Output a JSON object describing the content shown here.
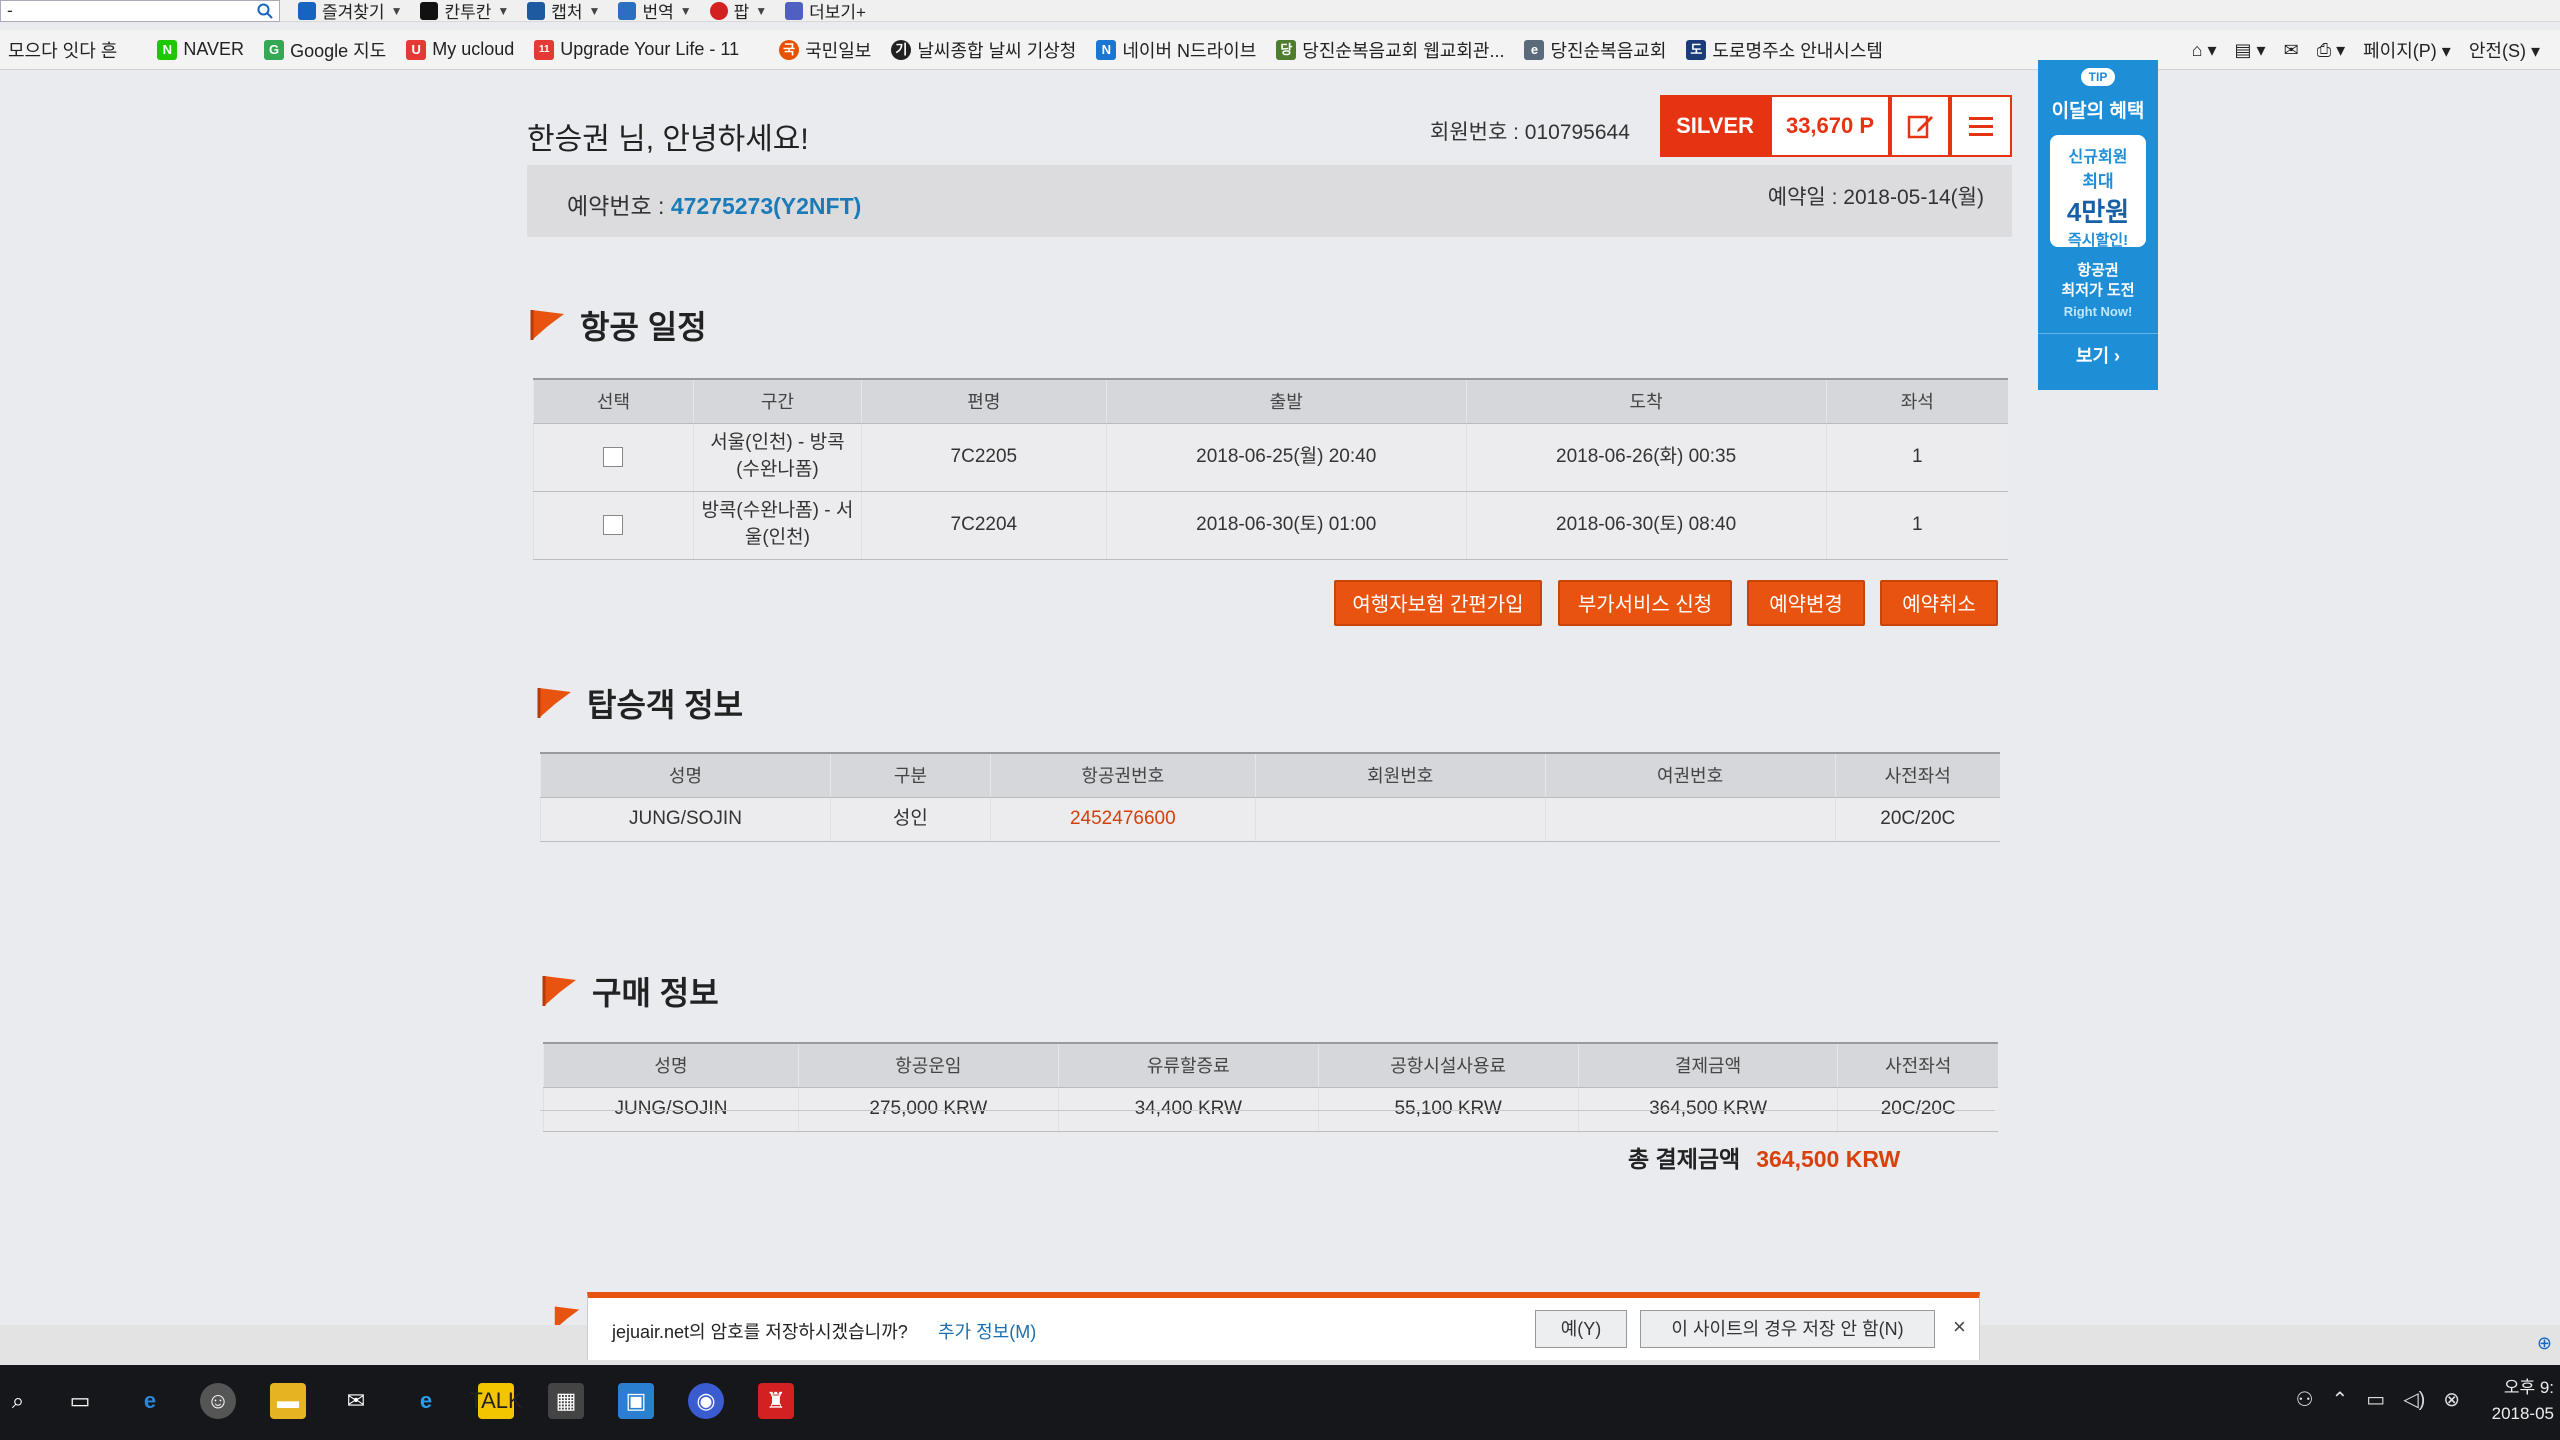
{
  "browser": {
    "address_text": "-",
    "toolbar": [
      {
        "label": "즐겨찾기",
        "color": "#1565c0"
      },
      {
        "label": "칸투칸",
        "color": "#111111"
      },
      {
        "label": "캡처",
        "color": "#1e5aa0"
      },
      {
        "label": "번역",
        "color": "#2a6fc0"
      },
      {
        "label": "팝",
        "color": "#d32020"
      },
      {
        "label": "더보기+",
        "color": "#5060c0"
      }
    ],
    "favorites_label": "모으다 잇다 흔",
    "favorites": [
      {
        "label": "NAVER",
        "color": "#1ec800",
        "letter": "N"
      },
      {
        "label": "Google 지도",
        "color": "#34a853",
        "letter": "G"
      },
      {
        "label": "My ucloud",
        "color": "#e53935",
        "letter": "U"
      },
      {
        "label": "Upgrade Your Life - 11",
        "color": "#e53935",
        "letter": "11"
      },
      {
        "label": "국민일보",
        "color": "#e65100",
        "letter": "국"
      },
      {
        "label": "날씨종합 날씨 기상청",
        "color": "#222222",
        "letter": "기"
      },
      {
        "label": "네이버 N드라이브",
        "color": "#1976d2",
        "letter": "N"
      },
      {
        "label": "당진순복음교회 웹교회관...",
        "color": "#4e7d2e",
        "letter": "당"
      },
      {
        "label": "당진순복음교회",
        "color": "#5a6a7a",
        "letter": "e"
      },
      {
        "label": "도로명주소 안내시스템",
        "color": "#1a3c78",
        "letter": "도"
      }
    ],
    "right_tools": [
      "페이지(P) ▾",
      "안전(S) ▾"
    ]
  },
  "header": {
    "welcome": "한승권 님, 안녕하세요!",
    "member_no": "회원번호 : 010795644",
    "grade": "SILVER",
    "points": "33,670 P"
  },
  "reservation": {
    "label": "예약번호 : ",
    "number": "47275273(Y2NFT)",
    "date": "예약일 : 2018-05-14(월)"
  },
  "flight_section": {
    "title": "항공 일정",
    "headers": [
      "선택",
      "구간",
      "편명",
      "출발",
      "도착",
      "좌석"
    ],
    "rows": [
      {
        "route": "서울(인천) - 방콕(수완나폼)",
        "flight": "7C2205",
        "depart": "2018-06-25(월) 20:40",
        "arrive": "2018-06-26(화) 00:35",
        "seats": "1"
      },
      {
        "route": "방콕(수완나폼) - 서울(인천)",
        "flight": "7C2204",
        "depart": "2018-06-30(토) 01:00",
        "arrive": "2018-06-30(토) 08:40",
        "seats": "1"
      }
    ],
    "buttons": [
      "여행자보험 간편가입",
      "부가서비스 신청",
      "예약변경",
      "예약취소"
    ]
  },
  "passenger_section": {
    "title": "탑승객 정보",
    "headers": [
      "성명",
      "구분",
      "항공권번호",
      "회원번호",
      "여권번호",
      "사전좌석"
    ],
    "rows": [
      {
        "name": "JUNG/SOJIN",
        "type": "성인",
        "ticket": "2452476600",
        "member": "",
        "passport": "",
        "seat": "20C/20C"
      }
    ]
  },
  "purchase_section": {
    "title": "구매 정보",
    "headers": [
      "성명",
      "항공운임",
      "유류할증료",
      "공항시설사용료",
      "결제금액",
      "사전좌석"
    ],
    "rows": [
      {
        "name": "JUNG/SOJIN",
        "fare": "275,000 KRW",
        "fuel": "34,400 KRW",
        "airport": "55,100 KRW",
        "payment": "364,500 KRW",
        "seat": "20C/20C"
      }
    ],
    "total_label": "총 결제금액",
    "total_amount": "364,500 KRW"
  },
  "tip_banner": {
    "badge": "TIP",
    "title": "이달의 혜택",
    "card": [
      "신규회원",
      "최대",
      "4만원",
      "즉시할인!"
    ],
    "sub": [
      "항공권",
      "최저가 도전"
    ],
    "sub2": "Right Now!",
    "view": "보기 ›"
  },
  "notification": {
    "message": "jejuair.net의 암호를 저장하시겠습니까?",
    "more": "추가 정보(M)",
    "yes": "예(Y)",
    "never": "이 사이트의 경우 저장 안 함(N)",
    "close": "×"
  },
  "taskbar": {
    "clock_time": "오후 9:",
    "clock_date": "2018-05"
  }
}
